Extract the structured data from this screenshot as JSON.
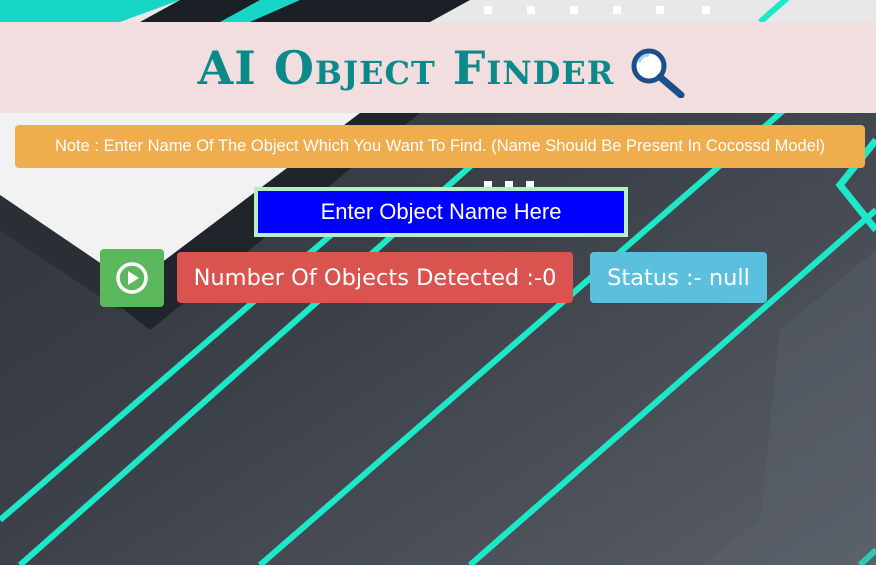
{
  "header": {
    "title": "AI Object Finder",
    "icon": "magnifier-icon"
  },
  "note": {
    "text": "Note : Enter Name Of The Object Which You Want To Find. (Name Should Be Present In Cocossd Model)"
  },
  "search": {
    "placeholder": "Enter Object Name Here",
    "value": ""
  },
  "controls": {
    "play_icon": "play-circle-icon",
    "count_text": "Number Of Objects Detected :-0",
    "status_text": "Status :- null"
  },
  "colors": {
    "header_bg": "#f2dede",
    "title": "#0c8a8a",
    "note_bg": "#f0ad4e",
    "input_bg": "#0000ff",
    "input_border": "#b7efc5",
    "play_bg": "#5cb85c",
    "count_bg": "#d9534f",
    "status_bg": "#5bc0de",
    "accent_lines": "#1de9c9"
  }
}
